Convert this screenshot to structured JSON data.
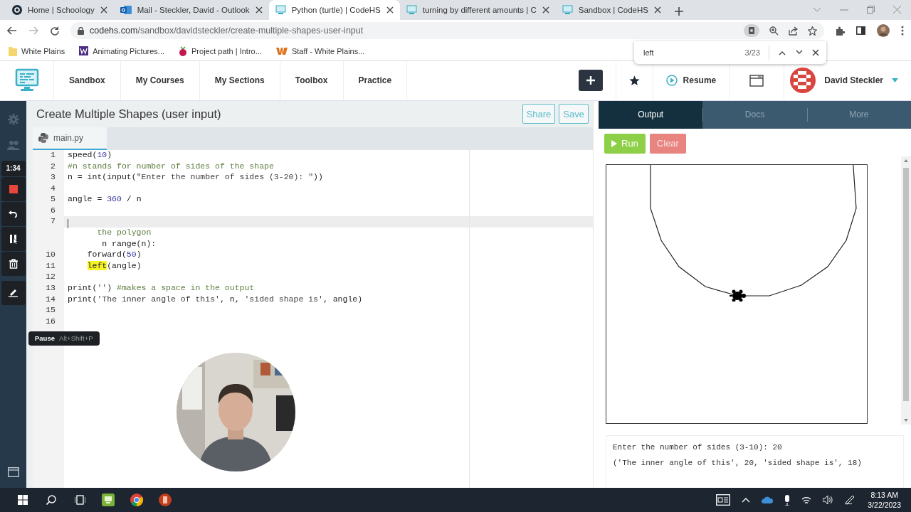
{
  "browser": {
    "tabs": [
      {
        "title": "Home | Schoology",
        "selected": false
      },
      {
        "title": "Mail - Steckler, David - Outlook",
        "selected": false
      },
      {
        "title": "Python (turtle) | CodeHS",
        "selected": true
      },
      {
        "title": "turning by different amounts | C",
        "selected": false
      },
      {
        "title": "Sandbox | CodeHS",
        "selected": false
      }
    ],
    "url_host": "codehs.com",
    "url_path": "/sandbox/davidsteckler/create-multiple-shapes-user-input",
    "bookmarks": [
      "White Plains",
      "Animating Pictures...",
      "Project path | Intro...",
      "Staff - White Plains..."
    ]
  },
  "find_bar": {
    "query": "left",
    "count": "3/23"
  },
  "nav": {
    "items": [
      "Sandbox",
      "My Courses",
      "My Sections",
      "Toolbox",
      "Practice"
    ],
    "resume": "Resume",
    "user": "David Steckler"
  },
  "sidebar": {
    "timer": "1:34"
  },
  "tooltip": {
    "label": "Pause",
    "shortcut": "Alt+Shift+P"
  },
  "editor": {
    "title": "Create Multiple Shapes (user input)",
    "buttons": [
      "Share",
      "Save"
    ],
    "file_tab": "main.py",
    "lines": [
      {
        "number": "1",
        "active": false,
        "text": "speed(10)"
      },
      {
        "number": "2",
        "active": false,
        "text": "#n stands for number of sides of the shape"
      },
      {
        "number": "3",
        "active": false,
        "text": "n = int(input(\"Enter the number of sides (3-20): \"))"
      },
      {
        "number": "4",
        "active": false
      },
      {
        "number": "5",
        "active": false,
        "text": "angle = 360 / n"
      },
      {
        "number": "6",
        "active": false
      },
      {
        "number": "7",
        "active": true
      },
      {
        "active": false,
        "text": "      the polygon",
        "kind": "comment"
      },
      {
        "active": false,
        "text": "       n range(n):"
      },
      {
        "number": "10",
        "active": false,
        "text": "    forward(50)"
      },
      {
        "number": "11",
        "active": false,
        "text": "    left(angle)"
      },
      {
        "number": "12",
        "active": false
      },
      {
        "number": "13",
        "active": false,
        "text": "print('') #makes a space in the output"
      },
      {
        "number": "14",
        "active": false,
        "text": "print('The inner angle of this', n, 'sided shape is', angle)"
      },
      {
        "number": "15",
        "active": false
      },
      {
        "number": "16",
        "active": false
      }
    ]
  },
  "output": {
    "tabs": [
      {
        "label": "Output",
        "selected": true
      },
      {
        "label": "Docs",
        "selected": false
      },
      {
        "label": "More",
        "selected": false
      }
    ],
    "buttons": [
      {
        "label": "Run",
        "kind": "run"
      },
      {
        "label": "Clear",
        "kind": "clear"
      }
    ],
    "console": [
      "Enter the number of sides (3-10): 20",
      "('The inner angle of this', 20, 'sided shape is', 18)"
    ]
  },
  "taskbar": {
    "time": "8:13 AM",
    "date": "3/22/2023"
  }
}
